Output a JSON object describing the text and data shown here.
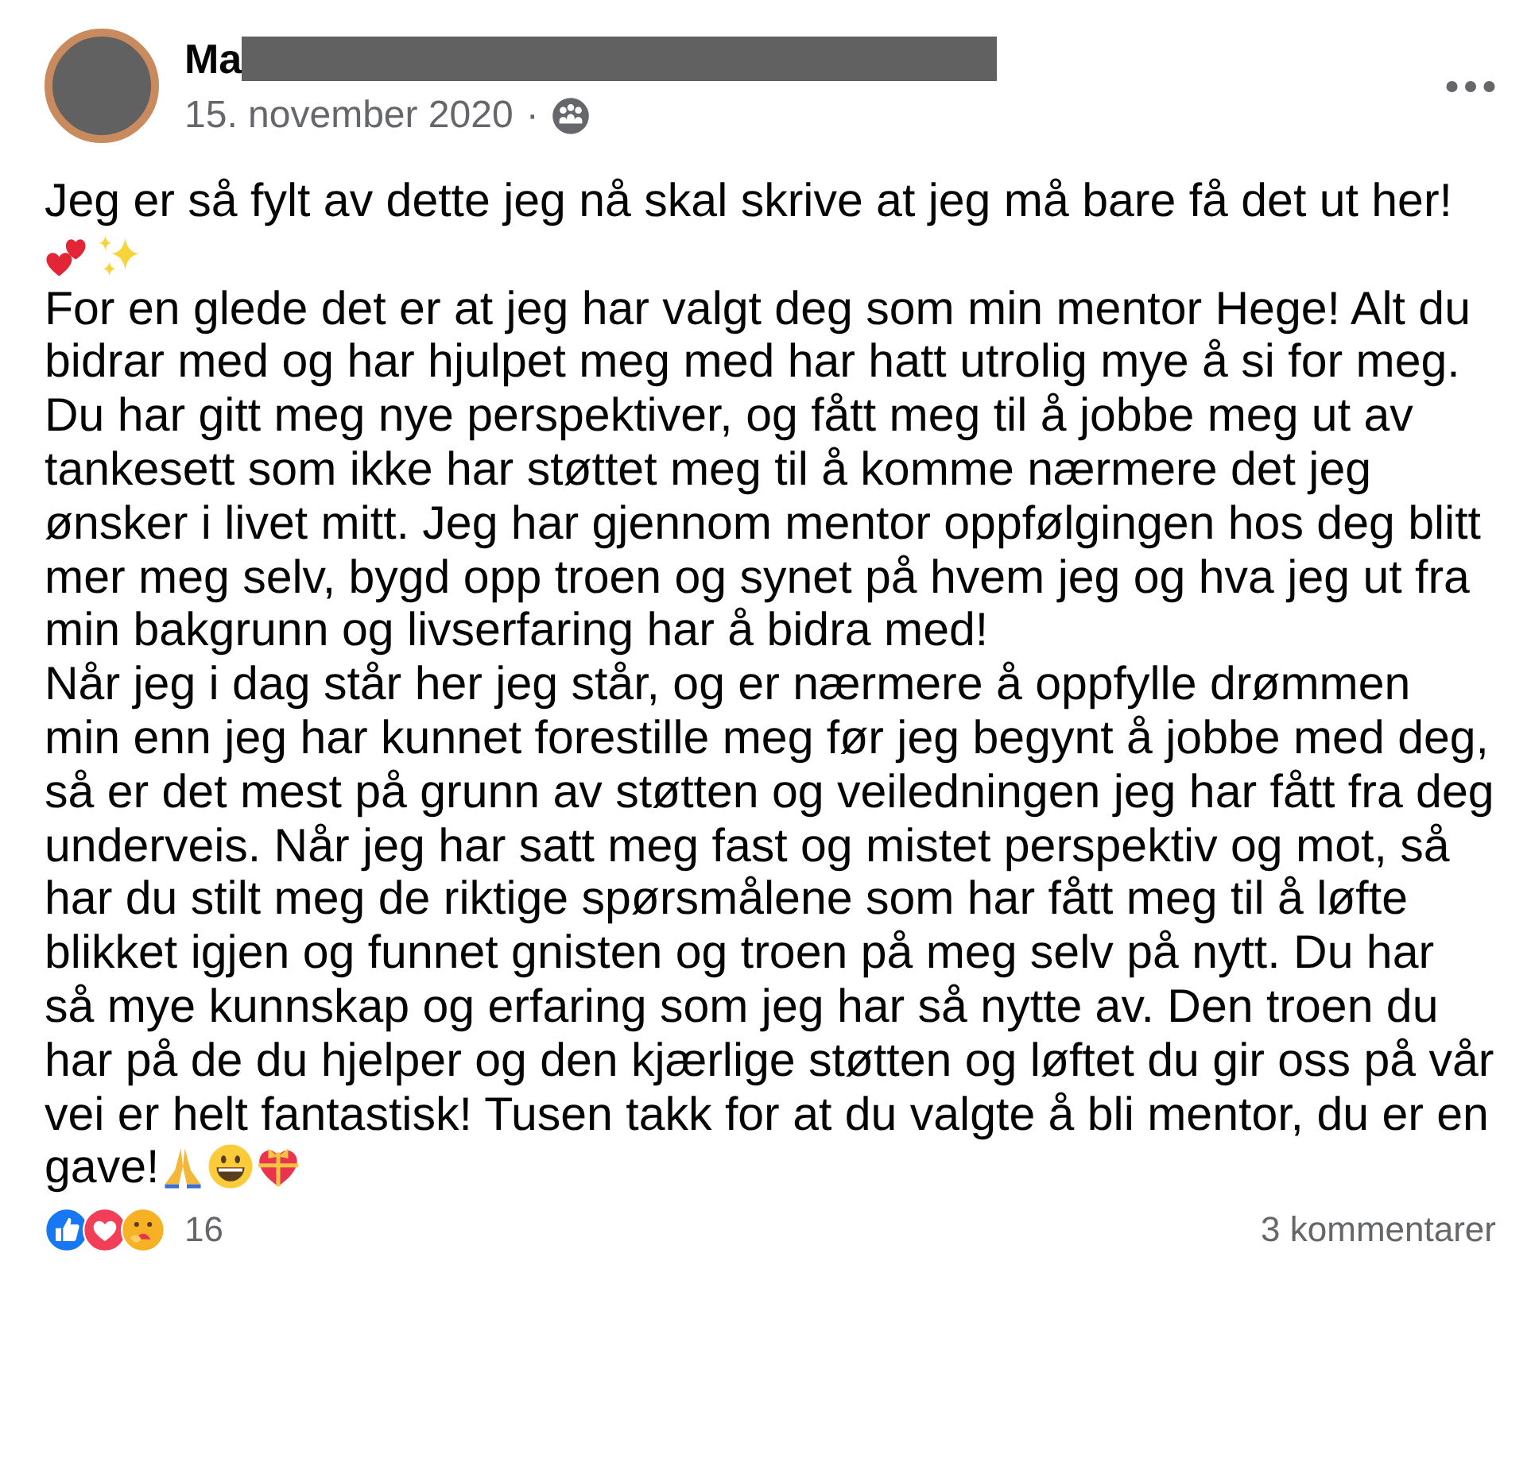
{
  "post": {
    "author": "Ma",
    "date": "15. november 2020",
    "separator": "·",
    "paragraphs": [
      {
        "text": "Jeg er så fylt av dette jeg nå skal skrive at jeg må bare få det ut her!"
      },
      {
        "text": "For en glede det er at jeg har valgt deg som min mentor Hege! Alt du bidrar med og har hjulpet meg med har hatt utrolig mye å si for meg."
      },
      {
        "text": "Du har gitt meg nye perspektiver, og fått meg til å jobbe meg ut av tankesett som ikke har støttet meg til å komme nærmere det jeg ønsker i livet mitt. Jeg har gjennom mentor oppfølgingen hos deg blitt mer meg selv, bygd opp troen og synet på hvem jeg og hva jeg ut fra min bakgrunn og livserfaring har å bidra med!"
      },
      {
        "text": "Når jeg i dag står her jeg står, og er nærmere å oppfylle drømmen min enn jeg har kunnet forestille meg før jeg begynt å jobbe med deg, så er det mest på grunn av støtten og veiledningen jeg har fått fra deg underveis. Når jeg har satt meg fast og mistet perspektiv og mot, så har du stilt meg de riktige spørsmålene som har fått meg til å løfte blikket igjen og funnet gnisten og troen på meg selv på nytt. Du har så mye kunnskap og erfaring som jeg har så nytte av. Den troen du har på de du hjelper og den kjærlige støtten og løftet du gir oss på vår vei er helt fantastisk! Tusen takk for at du valgte å bli mentor, du er en gave!"
      }
    ],
    "reactions": {
      "count": "16"
    },
    "comments": "3 kommentarer"
  }
}
